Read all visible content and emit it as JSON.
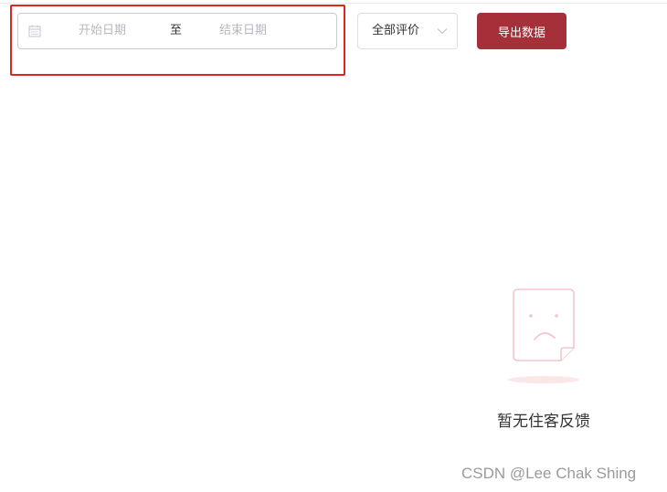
{
  "filters": {
    "date_range": {
      "start_placeholder": "开始日期",
      "separator": "至",
      "end_placeholder": "结束日期"
    },
    "rating_select": {
      "selected": "全部评价"
    }
  },
  "actions": {
    "export_label": "导出数据"
  },
  "empty_state": {
    "message": "暂无住客反馈"
  },
  "watermark": "CSDN @Lee Chak Shing",
  "colors": {
    "primary_button": "#a6303a",
    "highlight_border": "#e0251b",
    "illustration": "#f2c7cb"
  }
}
